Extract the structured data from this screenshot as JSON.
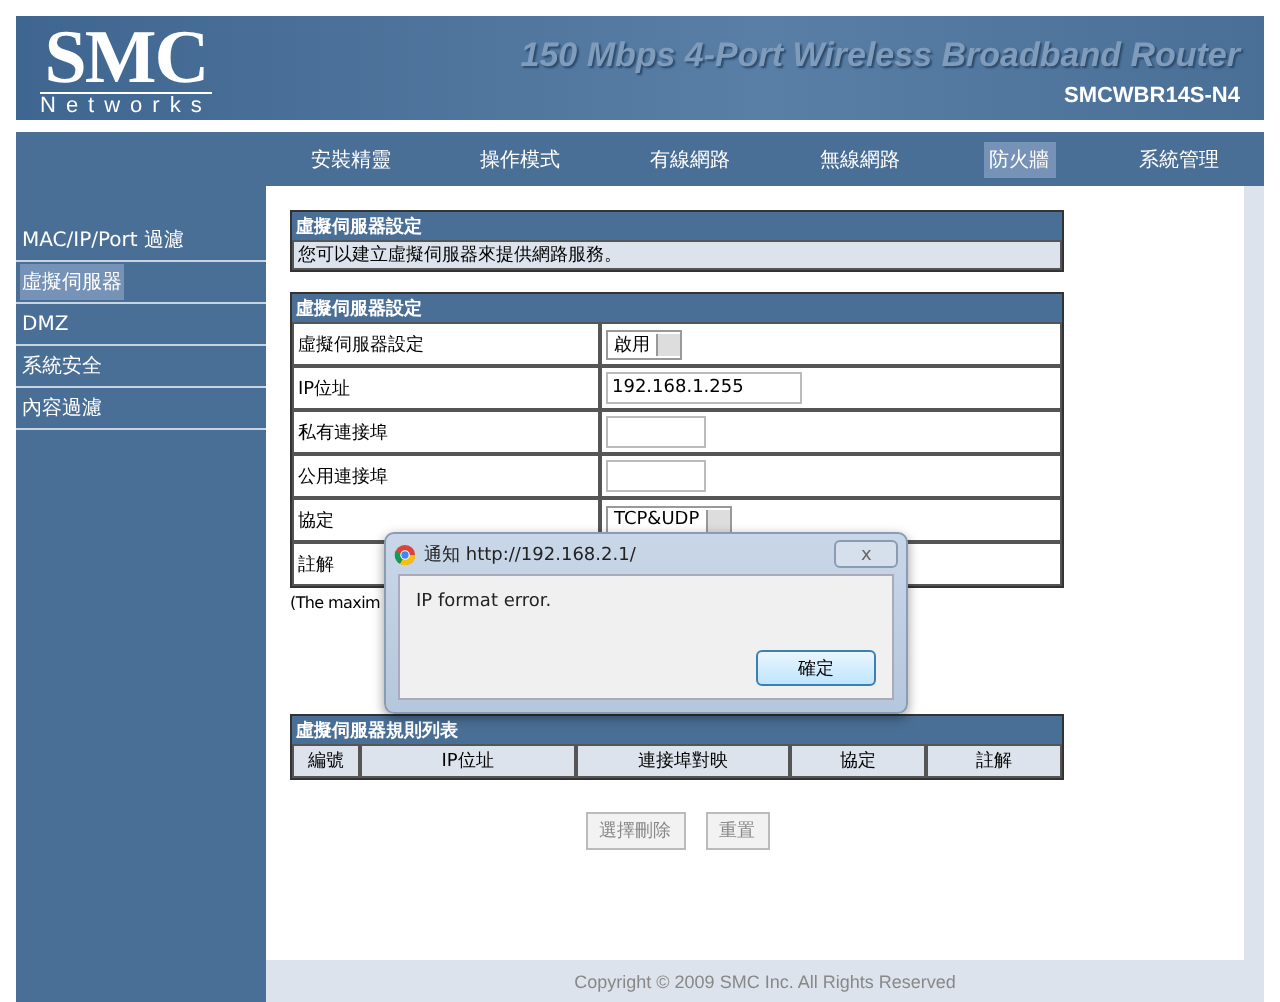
{
  "header": {
    "logo": "SMC",
    "logo_sub": "Networks",
    "title": "150 Mbps 4-Port Wireless Broadband Router",
    "model": "SMCWBR14S-N4"
  },
  "nav": [
    {
      "label": "安裝精靈",
      "selected": false
    },
    {
      "label": "操作模式",
      "selected": false
    },
    {
      "label": "有線網路",
      "selected": false
    },
    {
      "label": "無線網路",
      "selected": false
    },
    {
      "label": "防火牆",
      "selected": true
    },
    {
      "label": "系統管理",
      "selected": false
    }
  ],
  "sidebar": [
    {
      "label": "MAC/IP/Port 過濾",
      "selected": false
    },
    {
      "label": "虛擬伺服器",
      "selected": true
    },
    {
      "label": "DMZ",
      "selected": false
    },
    {
      "label": "系統安全",
      "selected": false
    },
    {
      "label": "內容過濾",
      "selected": false
    }
  ],
  "intro": {
    "title": "虛擬伺服器設定",
    "text": "您可以建立虛擬伺服器來提供網路服務。"
  },
  "settings": {
    "title": "虛擬伺服器設定",
    "rows": [
      {
        "label": "虛擬伺服器設定",
        "kind": "select",
        "value": "啟用"
      },
      {
        "label": "IP位址",
        "kind": "wide-input",
        "value": "192.168.1.255"
      },
      {
        "label": "私有連接埠",
        "kind": "input"
      },
      {
        "label": "公用連接埠",
        "kind": "input"
      },
      {
        "label": "協定",
        "kind": "select",
        "value": "TCP&UDP"
      },
      {
        "label": "註解",
        "kind": "none"
      }
    ]
  },
  "note": "(The maxim",
  "rules": {
    "title": "虛擬伺服器規則列表",
    "columns": [
      "編號",
      "IP位址",
      "連接埠對映",
      "協定",
      "註解"
    ]
  },
  "buttons": [
    "選擇刪除",
    "重置"
  ],
  "footer": "Copyright © 2009 SMC Inc. All Rights Reserved",
  "dialog": {
    "title": "通知 http://192.168.2.1/",
    "close": "ⅹ",
    "message": "IP format error.",
    "button": "確定"
  }
}
